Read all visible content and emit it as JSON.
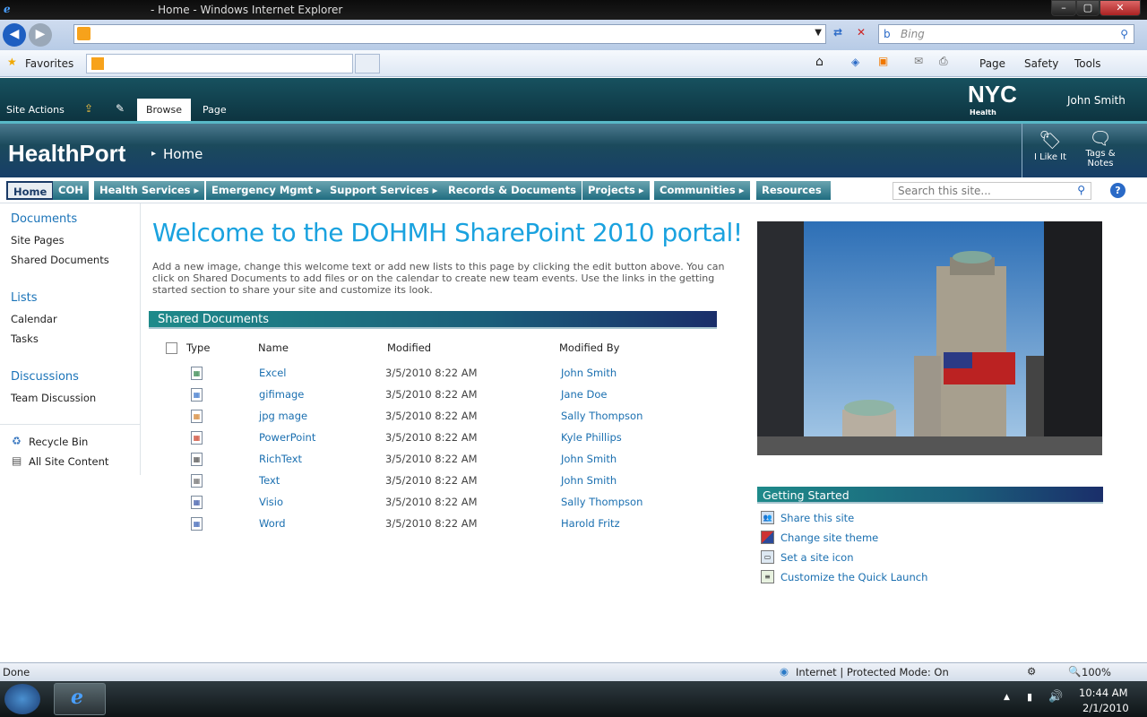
{
  "browser": {
    "window_title": "- Home - Windows Internet Explorer",
    "search_placeholder": "Bing",
    "favorites_label": "Favorites",
    "cmd_page": "Page",
    "cmd_safety": "Safety",
    "cmd_tools": "Tools",
    "status_text": "Done",
    "zone_text": "Internet | Protected Mode: On",
    "zoom": "100%"
  },
  "ribbon": {
    "site_actions": "Site Actions",
    "tab_browse": "Browse",
    "tab_page": "Page",
    "user": "John Smith",
    "logo_text": "NYC",
    "logo_sub": "Health"
  },
  "header": {
    "site_title": "HealthPort",
    "breadcrumb_current": "Home",
    "like_label": "I Like It",
    "tags_label": "Tags &",
    "tags_label2": "Notes"
  },
  "topnav": {
    "items": [
      "Home",
      "COH",
      "Health Services",
      "Emergency Mgmt",
      "Support Services",
      "Records & Documents",
      "Projects",
      "Communities",
      "Resources"
    ],
    "search_placeholder": "Search this site..."
  },
  "quicklaunch": {
    "documents": "Documents",
    "site_pages": "Site Pages",
    "shared_documents": "Shared Documents",
    "lists": "Lists",
    "calendar": "Calendar",
    "tasks": "Tasks",
    "discussions": "Discussions",
    "team_discussion": "Team Discussion",
    "recycle_bin": "Recycle Bin",
    "all_site_content": "All Site Content"
  },
  "main": {
    "welcome": "Welcome to the DOHMH SharePoint 2010 portal!",
    "intro": "Add a new image, change this welcome text or add new lists to this page by clicking the edit button above. You can click on Shared Documents to add files or on the calendar to create new team events. Use the links in the getting started section to share your site and customize its look.",
    "shared_docs_title": "Shared Documents",
    "columns": {
      "type": "Type",
      "name": "Name",
      "modified": "Modified",
      "modified_by": "Modified By"
    },
    "documents": [
      {
        "name": "Excel",
        "modified": "3/5/2010 8:22 AM",
        "by": "John Smith",
        "icon": "excel-icon"
      },
      {
        "name": "gifimage",
        "modified": "3/5/2010 8:22 AM",
        "by": "Jane Doe",
        "icon": "gif-icon"
      },
      {
        "name": "jpg mage",
        "modified": "3/5/2010 8:22 AM",
        "by": "Sally Thompson",
        "icon": "jpg-icon"
      },
      {
        "name": "PowerPoint",
        "modified": "3/5/2010 8:22 AM",
        "by": "Kyle Phillips",
        "icon": "powerpoint-icon"
      },
      {
        "name": "RichText",
        "modified": "3/5/2010 8:22 AM",
        "by": "John Smith",
        "icon": "richtext-icon"
      },
      {
        "name": "Text",
        "modified": "3/5/2010 8:22 AM",
        "by": "John Smith",
        "icon": "text-icon"
      },
      {
        "name": "Visio",
        "modified": "3/5/2010 8:22 AM",
        "by": "Sally Thompson",
        "icon": "visio-icon"
      },
      {
        "name": "Word",
        "modified": "3/5/2010 8:22 AM",
        "by": "Harold Fritz",
        "icon": "word-icon"
      }
    ],
    "getting_started_title": "Getting Started",
    "getting_started": [
      "Share this site",
      "Change site theme",
      "Set a site icon",
      "Customize the Quick Launch"
    ]
  },
  "taskbar": {
    "time": "10:44 AM",
    "date": "2/1/2010"
  }
}
